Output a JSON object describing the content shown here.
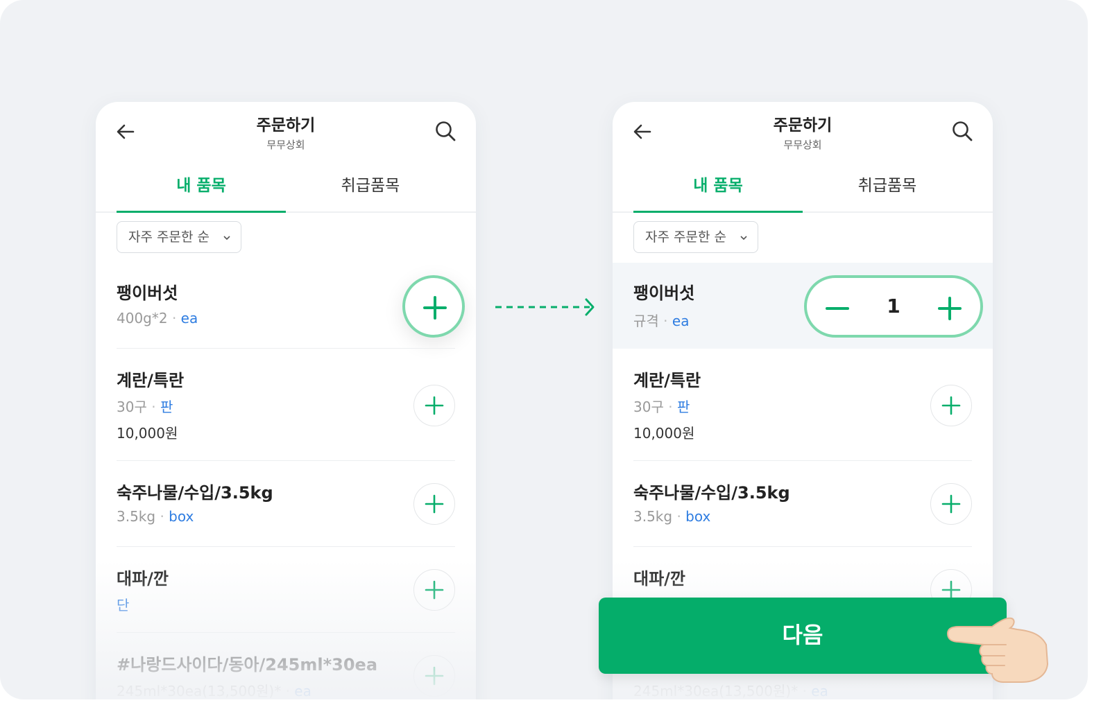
{
  "header": {
    "title": "주문하기",
    "subtitle": "무무상회"
  },
  "tabs": [
    {
      "label": "내 품목",
      "active": true
    },
    {
      "label": "취급품목",
      "active": false
    }
  ],
  "sort": {
    "label": "자주 주문한 순"
  },
  "left_items": [
    {
      "name": "팽이버섯",
      "spec": "400g*2",
      "unit": "ea"
    },
    {
      "name": "계란/특란",
      "spec": "30구",
      "unit": "판",
      "price": "10,000원"
    },
    {
      "name": "숙주나물/수입/3.5kg",
      "spec": "3.5kg",
      "unit": "box"
    },
    {
      "name": "대파/깐",
      "spec": "",
      "unit": "단"
    },
    {
      "name": "#나랑드사이다/동아/245ml*30ea",
      "spec": "245ml*30ea(13,500원)*",
      "unit": "ea"
    }
  ],
  "right_items": [
    {
      "name": "팽이버섯",
      "spec": "규격",
      "unit": "ea",
      "quantity": "1"
    },
    {
      "name": "계란/특란",
      "spec": "30구",
      "unit": "판",
      "price": "10,000원"
    },
    {
      "name": "숙주나물/수입/3.5kg",
      "spec": "3.5kg",
      "unit": "box"
    },
    {
      "name": "대파/깐"
    },
    {
      "spec": "245ml*30ea(13,500원)*",
      "unit": "ea"
    }
  ],
  "next_button": {
    "label": "다음"
  },
  "colors": {
    "accent": "#07ae6b",
    "button": "#05ad6a",
    "unit": "#2f7de1",
    "highlight_ring": "#7ed8ad"
  }
}
